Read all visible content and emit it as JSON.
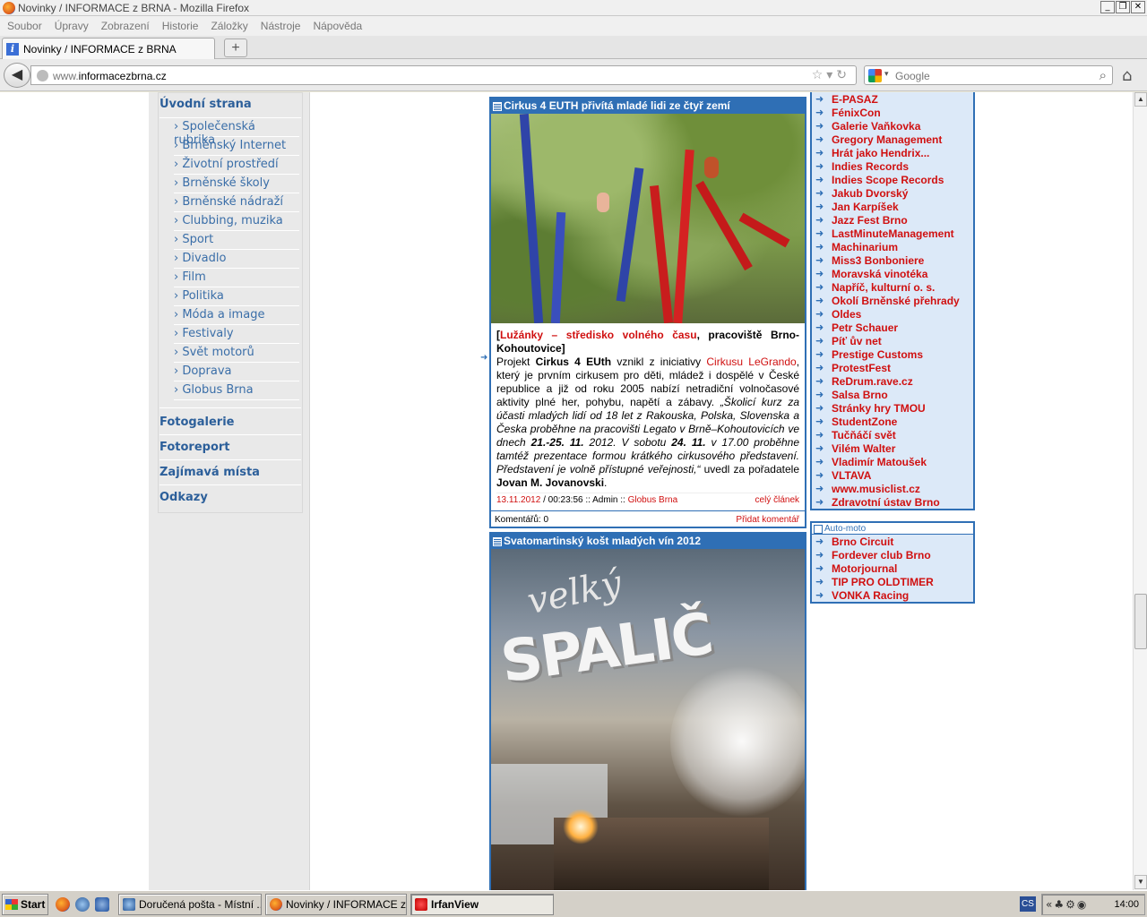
{
  "window": {
    "title": "Novinky / INFORMACE z BRNA - Mozilla Firefox",
    "controls": [
      "_",
      "❐",
      "✕"
    ]
  },
  "menu": [
    "Soubor",
    "Úpravy",
    "Zobrazení",
    "Historie",
    "Záložky",
    "Nástroje",
    "Nápověda"
  ],
  "tab": {
    "label": "Novinky / INFORMACE z BRNA",
    "new_tab": "+"
  },
  "nav": {
    "back": "◀",
    "url_prefix": "www.",
    "url_main": "informacezbrna.cz",
    "url_icons": "☆▾↻",
    "search_placeholder": "Google",
    "home": "⌂"
  },
  "sidebar": {
    "home": "Úvodní strana",
    "items": [
      "› Společenská rubrika",
      "› Brněnský Internet",
      "› Životní prostředí",
      "› Brněnské školy",
      "› Brněnské nádraží",
      "› Clubbing, muzika",
      "› Sport",
      "› Divadlo",
      "› Film",
      "› Politika",
      "› Móda a image",
      "› Festivaly",
      "› Svět motorů",
      "› Doprava",
      "› Globus Brna"
    ],
    "sections": [
      "Fotogalerie",
      "Fotoreport",
      "Zajímavá místa",
      "Odkazy"
    ]
  },
  "article1": {
    "title": "Cirkus 4 EUTH přivítá mladé lidi ze čtyř zemí",
    "source_open": "[",
    "source_link": "Lužánky – středisko volného času",
    "source_rest": ", pracoviště Brno-Kohoutovice]",
    "p1": "Projekt ",
    "p1_bold": "Cirkus 4 EUth",
    "p2": " vznikl z iniciativy ",
    "p2_link": "Cirkusu LeGrando",
    "p3": ", který je prvním cirkusem pro děti, mládež i dospělé v České republice a již od roku 2005 nabízí netradiční volnočasové aktivity plné her, pohybu, napětí a zábavy. ",
    "quote1": "„Školicí kurz za účasti mladých lidí od 18 let z Rakouska, Polska, Slovenska a Česka proběhne na pracovišti Legato v Brně–Kohoutovicích ve dnech ",
    "quote_bold1": "21.-25. 11.",
    "quote2": " 2012. V sobotu ",
    "quote_bold2": "24. 11.",
    "quote3": " v 17.00 proběhne tamtéž prezentace formou krátkého cirkusového představení. Představení je volně přístupné veřejnosti,“",
    "p4": " uvedl za pořadatele ",
    "author": "Jovan M. Jovanovski",
    "p5": ".",
    "meta_date": "13.11.2012",
    "meta_rest": " / 00:23:56 :: Admin :: ",
    "meta_cat": "Globus Brna",
    "meta_more": "celý článek",
    "comments": "Komentářů: 0",
    "add_comment": "Přidat komentář",
    "bullet": "➜"
  },
  "article2": {
    "title": "Svatomartinský košt mladých vín 2012"
  },
  "linkbox1": {
    "arrow": "➜",
    "links": [
      "E-PASAZ",
      "FénixCon",
      "Galerie Vaňkovka",
      "Gregory Management",
      "Hrát jako Hendrix...",
      "Indies Records",
      "Indies Scope Records",
      "Jakub Dvorský",
      "Jan Karpíšek",
      "Jazz Fest Brno",
      "LastMinuteManagement",
      "Machinarium",
      "Miss3 Bonboniere",
      "Moravská vinotéka",
      "Napříč, kulturní o. s.",
      "Okolí Brněnské přehrady",
      "Oldes",
      "Petr Schauer",
      "Píť ův net",
      "Prestige Customs",
      "ProtestFest",
      "ReDrum.rave.cz",
      "Salsa Brno",
      "Stránky hry TMOU",
      "StudentZone",
      "Tučňáčí svět",
      "Vilém Walter",
      "Vladimír Matoušek",
      "VLTAVA",
      "www.musiclist.cz",
      "Zdravotní ústav Brno"
    ]
  },
  "linkbox2": {
    "title": "Auto-moto",
    "links": [
      "Brno Circuit",
      "Fordever club Brno",
      "Motorjournal",
      "TIP PRO OLDTIMER",
      "VONKA Racing"
    ]
  },
  "scroll": {
    "up": "▲",
    "down": "▼"
  },
  "taskbar": {
    "start": "Start",
    "tasks": [
      "Doručená pošta - Místní ...",
      "Novinky / INFORMACE z ...",
      "IrfanView"
    ],
    "lang": "CS",
    "tray_icons": "«♣⚙◉",
    "clock": "14:00"
  },
  "colors": {
    "accent": "#2f6fb5",
    "link_red": "#d01010",
    "sidebar_link": "#3a6ea8",
    "box_bg": "#dce9f8"
  }
}
